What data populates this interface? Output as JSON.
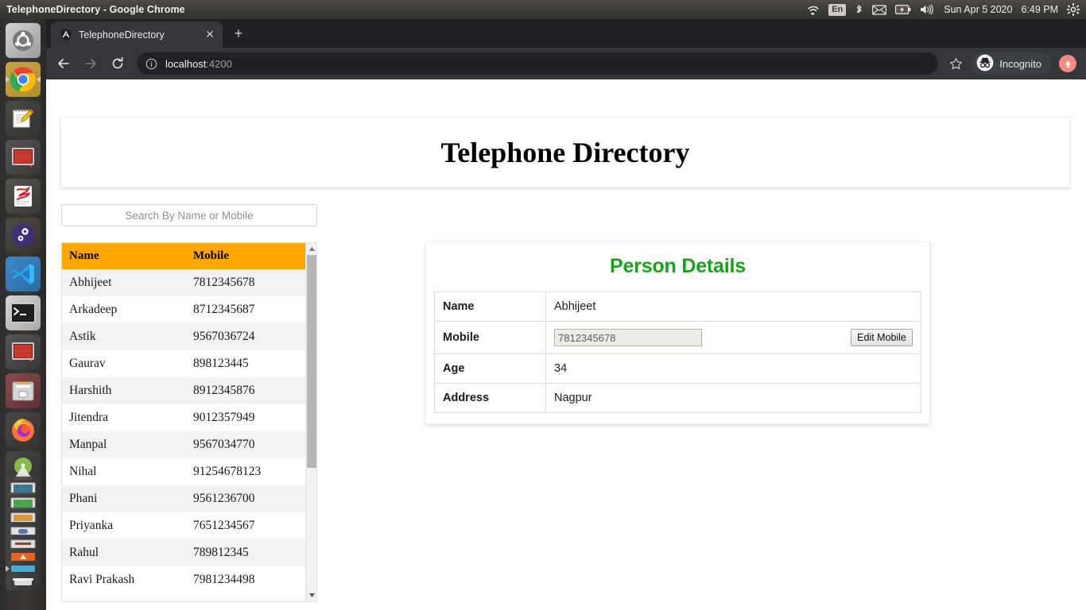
{
  "os_panel": {
    "window_title": "TelephoneDirectory - Google Chrome",
    "indicators": [
      "wifi-icon",
      "keyboard-layout",
      "bluetooth-icon",
      "mail-icon",
      "battery-icon",
      "volume-icon"
    ],
    "keyboard_layout": "En",
    "datetime": "Sun Apr  5 2020",
    "clock": "6:49 PM",
    "settings_icon": "gear-icon"
  },
  "launcher": {
    "items": [
      {
        "name": "ubuntu-dash",
        "label": "Ubuntu"
      },
      {
        "name": "google-chrome",
        "label": "Google Chrome"
      },
      {
        "name": "text-editor",
        "label": "Text Editor"
      },
      {
        "name": "red-tiles-app",
        "label": "Application"
      },
      {
        "name": "document-viewer",
        "label": "Document Viewer"
      },
      {
        "name": "system-settings",
        "label": "System Settings"
      },
      {
        "name": "vs-code",
        "label": "Visual Studio Code"
      },
      {
        "name": "terminal",
        "label": "Terminal"
      },
      {
        "name": "red-tiles-app-2",
        "label": "Application"
      },
      {
        "name": "files",
        "label": "Files"
      },
      {
        "name": "firefox",
        "label": "Firefox"
      },
      {
        "name": "android-studio",
        "label": "Android Studio"
      }
    ]
  },
  "browser": {
    "tab": {
      "title": "TelephoneDirectory",
      "favicon": "angular-shield-icon",
      "close_label": "✕"
    },
    "new_tab_label": "+",
    "nav": {
      "back": "←",
      "forward": "→",
      "reload": "⟳"
    },
    "omnibox": {
      "info_icon": "site-info-icon",
      "host": "localhost",
      "port": ":4200"
    },
    "bookmark_icon": "star-icon",
    "incognito_label": "Incognito",
    "incognito_icon": "incognito-hat-icon",
    "profile_icon": "profile-avatar"
  },
  "page": {
    "title": "Telephone Directory",
    "search": {
      "placeholder": "Search By Name or Mobile",
      "value": ""
    },
    "directory": {
      "columns": [
        "Name",
        "Mobile"
      ],
      "rows": [
        {
          "name": "Abhijeet",
          "mobile": "7812345678"
        },
        {
          "name": "Arkadeep",
          "mobile": "8712345687"
        },
        {
          "name": "Astik",
          "mobile": "9567036724"
        },
        {
          "name": "Gaurav",
          "mobile": "898123445"
        },
        {
          "name": "Harshith",
          "mobile": "8912345876"
        },
        {
          "name": "Jitendra",
          "mobile": "9012357949"
        },
        {
          "name": "Manpal",
          "mobile": "9567034770"
        },
        {
          "name": "Nihal",
          "mobile": "91254678123"
        },
        {
          "name": "Phani",
          "mobile": "9561236700"
        },
        {
          "name": "Priyanka",
          "mobile": "7651234567"
        },
        {
          "name": "Rahul",
          "mobile": "789812345"
        },
        {
          "name": "Ravi Prakash",
          "mobile": "7981234498"
        }
      ]
    },
    "details": {
      "heading": "Person Details",
      "heading_color": "#19a219",
      "fields": {
        "name_label": "Name",
        "name_value": "Abhijeet",
        "mobile_label": "Mobile",
        "mobile_value": "7812345678",
        "edit_mobile_button": "Edit Mobile",
        "age_label": "Age",
        "age_value": "34",
        "address_label": "Address",
        "address_value": "Nagpur"
      }
    },
    "theme": {
      "header_accent": "#ffa700",
      "details_heading": "#19a219"
    }
  }
}
